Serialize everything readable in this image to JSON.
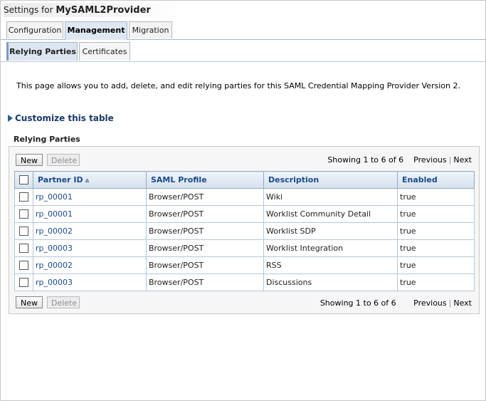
{
  "header": {
    "title_prefix": "Settings for ",
    "title_name": "MySAML2Provider"
  },
  "tabs_primary": [
    {
      "label": "Configuration"
    },
    {
      "label": "Management"
    },
    {
      "label": "Migration"
    }
  ],
  "tabs_secondary": [
    {
      "label": "Relying Parties"
    },
    {
      "label": "Certificates"
    }
  ],
  "description": "This page allows you to add, delete, and edit relying parties for this SAML Credential Mapping Provider Version 2.",
  "customize_label": "Customize this table",
  "section_title": "Relying Parties",
  "toolbar": {
    "new_label": "New",
    "delete_label": "Delete"
  },
  "pager": {
    "showing": "Showing 1 to 6 of 6",
    "previous": "Previous",
    "next": "Next"
  },
  "columns": [
    "Partner ID",
    "SAML Profile",
    "Description",
    "Enabled"
  ],
  "rows": [
    {
      "id": "rp_00001",
      "profile": "Browser/POST",
      "description": "Wiki",
      "enabled": "true"
    },
    {
      "id": "rp_00001",
      "profile": "Browser/POST",
      "description": "Worklist Community Detail",
      "enabled": "true"
    },
    {
      "id": "rp_00002",
      "profile": "Browser/POST",
      "description": "Worklist SDP",
      "enabled": "true"
    },
    {
      "id": "rp_00003",
      "profile": "Browser/POST",
      "description": "Worklist Integration",
      "enabled": "true"
    },
    {
      "id": "rp_00002",
      "profile": "Browser/POST",
      "description": "RSS",
      "enabled": "true"
    },
    {
      "id": "rp_00003",
      "profile": "Browser/POST",
      "description": "Discussions",
      "enabled": "true"
    }
  ],
  "icons": {
    "sort": "sort-ascending-icon",
    "expand": "expand-arrow-icon"
  },
  "colors": {
    "link": "#1a4a8c",
    "header_bg": "#d6e1ee",
    "active_tab": "#dfe8f2"
  }
}
